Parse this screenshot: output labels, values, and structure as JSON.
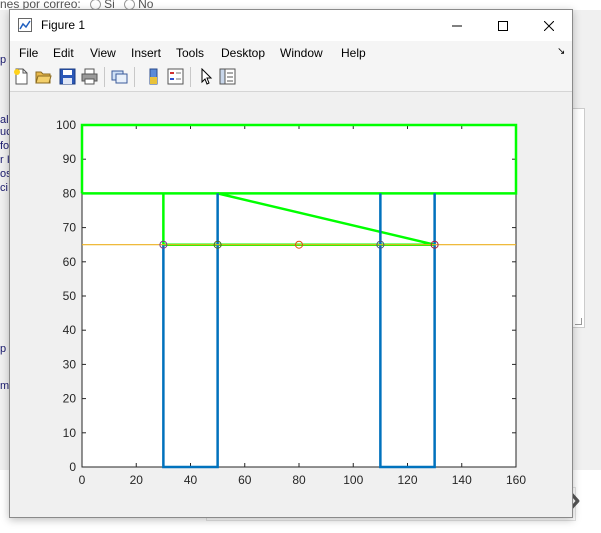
{
  "window": {
    "title": "Figure 1",
    "menu": [
      "File",
      "Edit",
      "View",
      "Insert",
      "Tools",
      "Desktop",
      "Window",
      "Help"
    ],
    "menu_arrow": "↘"
  },
  "background": {
    "top_text": "nes por correo:",
    "radio_si": "Si",
    "radio_no": "No",
    "left_fragments": [
      "p",
      "al",
      "uc",
      "fo",
      "r I",
      "os",
      "ci",
      "p",
      "m"
    ]
  },
  "colors": {
    "green": "#00ff00",
    "blue": "#0072bd",
    "orange": "#edb120",
    "red_marker": "#d95319"
  },
  "chart_data": {
    "type": "line",
    "title": "",
    "xlabel": "",
    "ylabel": "",
    "xlim": [
      0,
      160
    ],
    "ylim": [
      0,
      100
    ],
    "xticks": [
      0,
      20,
      40,
      60,
      80,
      100,
      120,
      140,
      160
    ],
    "yticks": [
      0,
      10,
      20,
      30,
      40,
      50,
      60,
      70,
      80,
      90,
      100
    ],
    "grid": false,
    "series": [
      {
        "color": "#00ff00",
        "width": 2.5,
        "points": [
          [
            0,
            80
          ],
          [
            0,
            100
          ],
          [
            160,
            100
          ],
          [
            160,
            80
          ],
          [
            0,
            80
          ]
        ]
      },
      {
        "color": "#00ff00",
        "width": 2.5,
        "points": [
          [
            30,
            80
          ],
          [
            30,
            65
          ],
          [
            130,
            65
          ]
        ]
      },
      {
        "color": "#00ff00",
        "width": 2.5,
        "points": [
          [
            50,
            80
          ],
          [
            130,
            65
          ]
        ]
      },
      {
        "color": "#0072bd",
        "width": 2.5,
        "points": [
          [
            30,
            65
          ],
          [
            30,
            0
          ],
          [
            50,
            0
          ],
          [
            50,
            80
          ]
        ]
      },
      {
        "color": "#0072bd",
        "width": 2.5,
        "points": [
          [
            110,
            80
          ],
          [
            110,
            0
          ],
          [
            130,
            0
          ],
          [
            130,
            80
          ]
        ]
      },
      {
        "color": "#edb120",
        "width": 1.2,
        "points": [
          [
            0,
            65
          ],
          [
            160,
            65
          ]
        ]
      }
    ],
    "markers": [
      {
        "x": 30,
        "y": 65,
        "color": "#7a3b8f"
      },
      {
        "x": 50,
        "y": 65,
        "color": "#4a6b2a"
      },
      {
        "x": 80,
        "y": 65,
        "color": "#d95319"
      },
      {
        "x": 110,
        "y": 65,
        "color": "#4a5a7a"
      },
      {
        "x": 130,
        "y": 65,
        "color": "#a0204a"
      }
    ]
  }
}
